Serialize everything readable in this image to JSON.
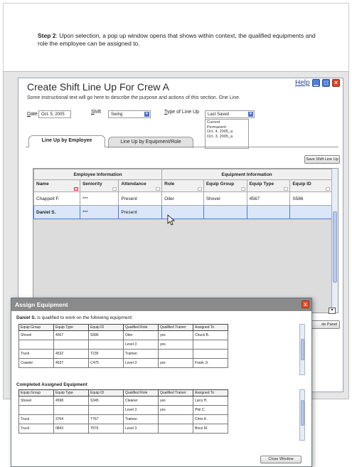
{
  "step": {
    "label": "Step 2",
    "text": ": Upon selection, a pop up window opens that shows within context, the qualified equipments and role the employee can be assigned to."
  },
  "window": {
    "title": "Create Shift Line Up For Crew A",
    "help_label": "Help",
    "instructions": "Some instructional text will go here to describe the purpose and actions of this section.  One Line."
  },
  "form": {
    "date_label_u": "D",
    "date_label_rest": "ate",
    "date_value": "Oct. 5, 2005",
    "shift_label_u": "S",
    "shift_label_rest": "hift",
    "shift_value": "Swing",
    "type_label_u": "T",
    "type_label_rest": "ype of Line Up",
    "type_value": "Last Saved",
    "type_options": [
      "Current",
      "Permanent",
      "Oct. 4, 2005_a",
      "Oct. 3, 2005_a"
    ]
  },
  "tabs": [
    "Line Up by Employee",
    "Line Up by Equipment/Role"
  ],
  "save_button": "Save Shift Line Up",
  "panel_button": "de Panel",
  "employee_grid": {
    "group_headers": [
      "Employee Information",
      "Equipment Information"
    ],
    "columns": [
      "Name",
      "Seniority",
      "Attendance",
      "Role",
      "Equip Group",
      "Equip Type",
      "Equip ID"
    ],
    "rows": [
      [
        "Chappell F.",
        "***",
        "Present",
        "Oiler",
        "Shovel",
        "4567",
        "S586"
      ],
      [
        "Daniel S.",
        "***",
        "Present",
        "",
        "",
        "",
        ""
      ]
    ]
  },
  "dialog": {
    "title": "Assign Equipment",
    "close_glyph": "x",
    "subtitle_name": "Daniel S.",
    "subtitle_rest": " is qualified to work on the following equipment:",
    "columns": [
      "Equip Group",
      "Equip Type",
      "Equip ID",
      "Qualified Role",
      "Qualified Trainer",
      "Assigned To"
    ],
    "qualified_rows": [
      [
        "Shovel",
        "4567",
        "S586",
        "Oiler",
        "yes",
        "Chuck B."
      ],
      [
        "",
        "",
        "",
        "Level 3",
        "yes",
        ""
      ],
      [
        "Truck",
        "4532",
        "T235",
        "Trainee",
        "",
        ""
      ],
      [
        "Crawler",
        "4537",
        "C475",
        "Level 3",
        "yes",
        "Frank Jr."
      ]
    ],
    "completed_title": "Completed Assigned Equipment",
    "completed_rows": [
      [
        "Shovel",
        "4598",
        "S345",
        "Cleaner",
        "yes",
        "Larry H."
      ],
      [
        "",
        "",
        "",
        "Level 3",
        "yes",
        "Phil C."
      ],
      [
        "Truck",
        "3764",
        "T767",
        "Trainee",
        "",
        "Chris K."
      ],
      [
        "Truck",
        "0843",
        "T876",
        "Level 3",
        "",
        "Brice M."
      ]
    ],
    "close_window_label": "Close Window"
  }
}
